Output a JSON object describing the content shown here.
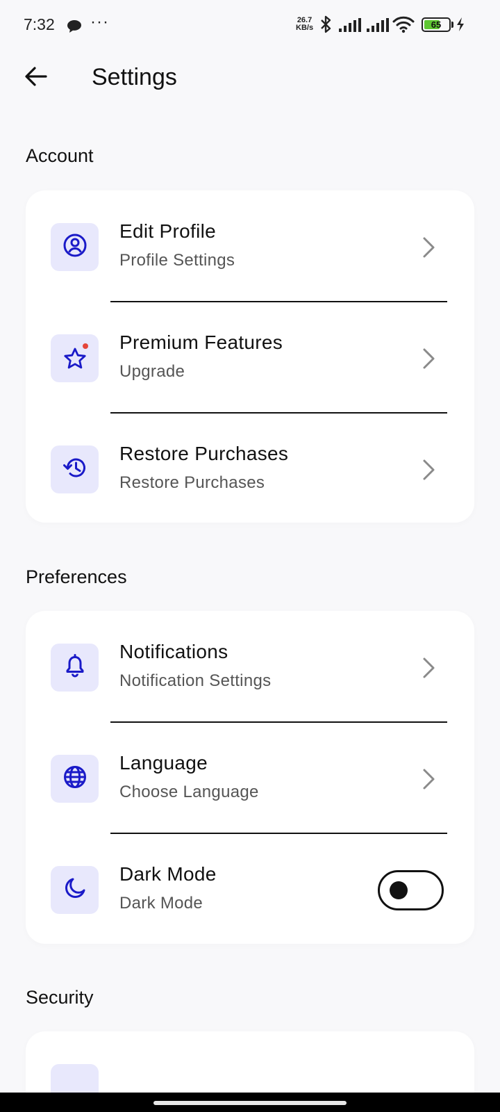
{
  "status_bar": {
    "time": "7:32",
    "dots": "···",
    "speed_value": "26.7",
    "speed_unit": "KB/s",
    "battery_level": "65",
    "battery_fraction": 0.65,
    "battery_color": "#5fc733"
  },
  "header": {
    "title": "Settings",
    "back_icon": "arrow-left-icon"
  },
  "sections": [
    {
      "title": "Account",
      "items": [
        {
          "title": "Edit Profile",
          "subtitle": "Profile Settings",
          "icon": "account-circle-icon",
          "trailing": "chevron"
        },
        {
          "title": "Premium Features",
          "subtitle": "Upgrade",
          "icon": "star-icon",
          "trailing": "chevron",
          "badge": true
        },
        {
          "title": "Restore Purchases",
          "subtitle": "Restore Purchases",
          "icon": "history-icon",
          "trailing": "chevron"
        }
      ]
    },
    {
      "title": "Preferences",
      "items": [
        {
          "title": "Notifications",
          "subtitle": "Notification Settings",
          "icon": "bell-icon",
          "trailing": "chevron"
        },
        {
          "title": "Language",
          "subtitle": "Choose Language",
          "icon": "globe-icon",
          "trailing": "chevron"
        },
        {
          "title": "Dark Mode",
          "subtitle": "Dark Mode",
          "icon": "moon-icon",
          "trailing": "toggle",
          "toggle_on": false
        }
      ]
    },
    {
      "title": "Security",
      "items": []
    }
  ],
  "colors": {
    "accent": "#1a1ac8",
    "icon_background": "#e8e8fc",
    "badge": "#e5463a",
    "background": "#f8f8fa"
  }
}
